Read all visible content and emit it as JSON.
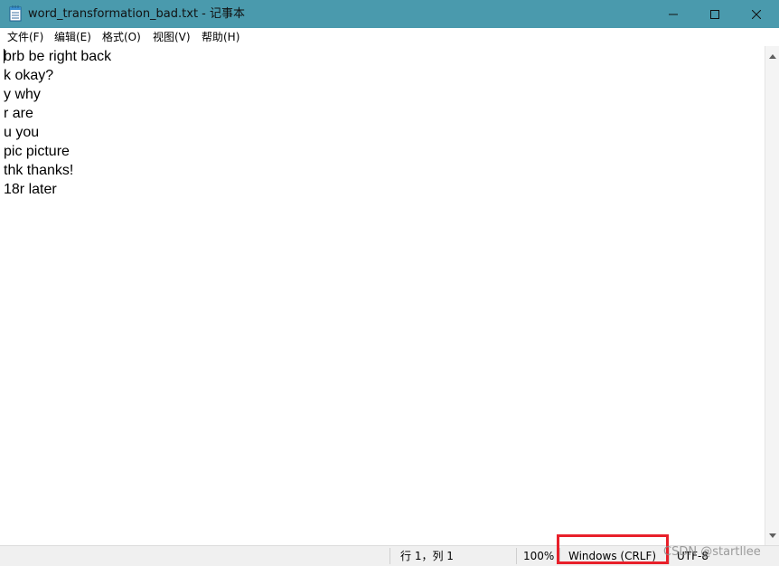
{
  "window": {
    "title": "word_transformation_bad.txt - 记事本"
  },
  "menu": [
    {
      "label": "文件(F)"
    },
    {
      "label": "编辑(E)"
    },
    {
      "label": "格式(O)"
    },
    {
      "label": "视图(V)"
    },
    {
      "label": "帮助(H)"
    }
  ],
  "editor": {
    "lines": [
      "brb be right back",
      "k okay?",
      "y why",
      "r are",
      "u you",
      "pic picture",
      "thk thanks!",
      "18r later"
    ]
  },
  "status": {
    "position": "行 1，列 1",
    "zoom": "100%",
    "line_ending": "Windows (CRLF)",
    "encoding": "UTF-8"
  },
  "watermark": "CSDN @startllee",
  "colors": {
    "titlebar": "#4a9aad",
    "highlight": "#e8202a"
  }
}
